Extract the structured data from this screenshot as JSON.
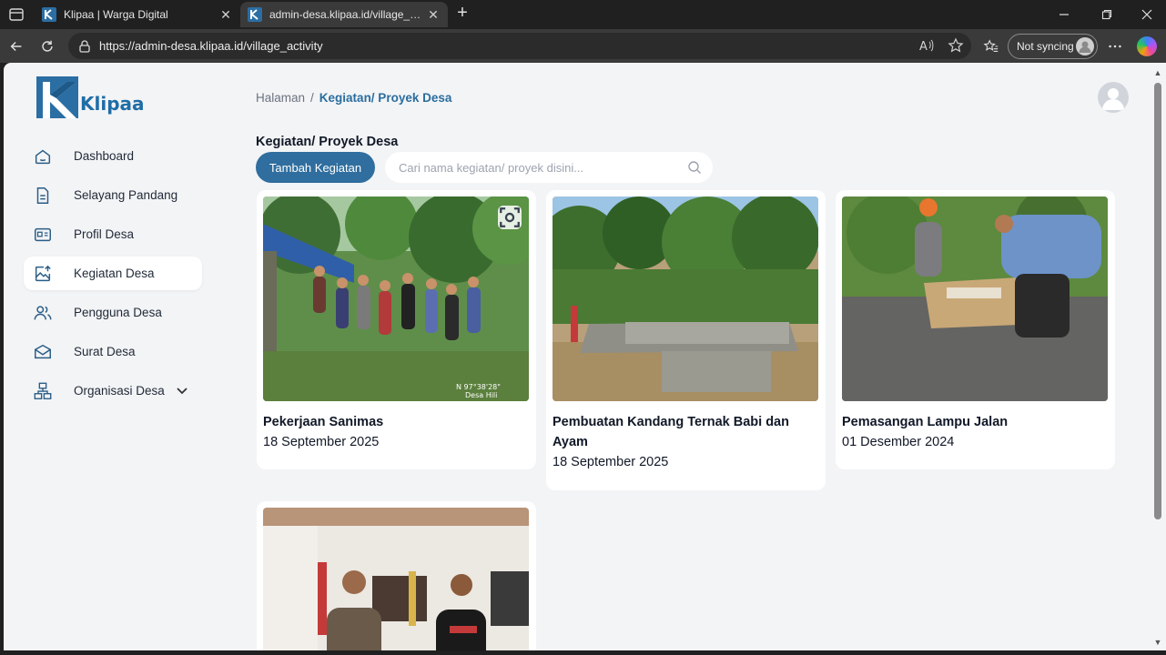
{
  "browser": {
    "tabs": [
      {
        "title": "Klipaa | Warga Digital",
        "active": false
      },
      {
        "title": "admin-desa.klipaa.id/village_activity",
        "active": true
      }
    ],
    "url": "https://admin-desa.klipaa.id/village_activity",
    "sync_label": "Not syncing"
  },
  "brand": {
    "name": "Klipaa",
    "color": "#1f6da6"
  },
  "sidebar": {
    "items": [
      {
        "label": "Dashboard",
        "icon": "home-icon"
      },
      {
        "label": "Selayang Pandang",
        "icon": "document-icon"
      },
      {
        "label": "Profil Desa",
        "icon": "id-card-icon"
      },
      {
        "label": "Kegiatan Desa",
        "icon": "image-upload-icon",
        "active": true
      },
      {
        "label": "Pengguna Desa",
        "icon": "users-icon"
      },
      {
        "label": "Surat Desa",
        "icon": "mail-icon"
      },
      {
        "label": "Organisasi Desa",
        "icon": "org-chart-icon",
        "expandable": true
      }
    ]
  },
  "header": {
    "breadcrumb_root": "Halaman",
    "breadcrumb_sep": "/",
    "breadcrumb_current": "Kegiatan/ Proyek Desa"
  },
  "main": {
    "title": "Kegiatan/ Proyek Desa",
    "add_button": "Tambah Kegiatan",
    "search_placeholder": "Cari nama kegiatan/ proyek disini...",
    "accent_color": "#2f6e9e",
    "cards": [
      {
        "title": "Pekerjaan Sanimas",
        "date": "18 September 2025"
      },
      {
        "title": "Pembuatan Kandang Ternak Babi dan Ayam",
        "date": "18 September 2025"
      },
      {
        "title": "Pemasangan Lampu Jalan",
        "date": "01 Desember 2024"
      },
      {
        "title": "",
        "date": ""
      }
    ]
  }
}
